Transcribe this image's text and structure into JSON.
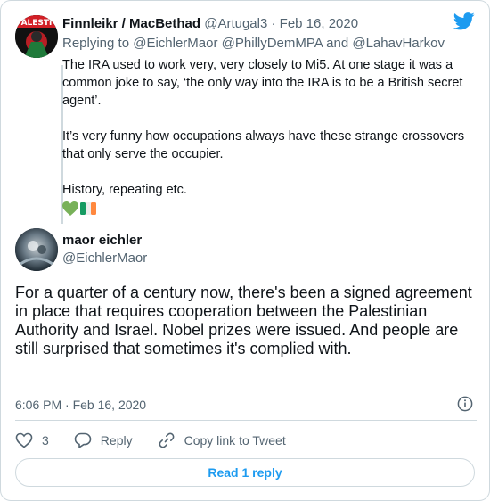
{
  "parent": {
    "avatar_text": "ALESTI",
    "name": "Finnleikr / MacBethad",
    "handle": "@Artugal3",
    "separator": "·",
    "date": "Feb 16, 2020",
    "replying_prefix": "Replying to",
    "replying_to": [
      "@EichlerMaor",
      "@PhillyDemMPA"
    ],
    "replying_and": "and",
    "replying_last": "@LahavHarkov",
    "paragraphs": [
      "The IRA used to work very, very closely to Mi5. At one stage it was a common joke to say, ‘the only way into the IRA is to be a British secret agent’.",
      "It’s very funny how occupations always have these strange crossovers that only serve the occupier.",
      "History, repeating etc."
    ],
    "emojis": [
      "green-heart",
      "ireland-flag"
    ]
  },
  "main": {
    "name": "maor eichler",
    "handle": "@EichlerMaor",
    "text": "For a quarter of a century now, there's been a signed agreement in place that requires cooperation between the Palestinian Authority and Israel. Nobel prizes were issued. And people are still surprised that sometimes it's complied with.",
    "timestamp": "6:06 PM · Feb 16, 2020"
  },
  "actions": {
    "like_count": "3",
    "reply_label": "Reply",
    "copy_label": "Copy link to Tweet"
  },
  "read_replies_label": "Read 1 reply",
  "colors": {
    "accent": "#1d9bf0",
    "muted": "#536471",
    "border": "#cfd9de",
    "heart": "#78b159"
  },
  "icons": [
    "twitter-bird-icon",
    "info-icon",
    "heart-icon",
    "reply-icon",
    "link-icon"
  ]
}
